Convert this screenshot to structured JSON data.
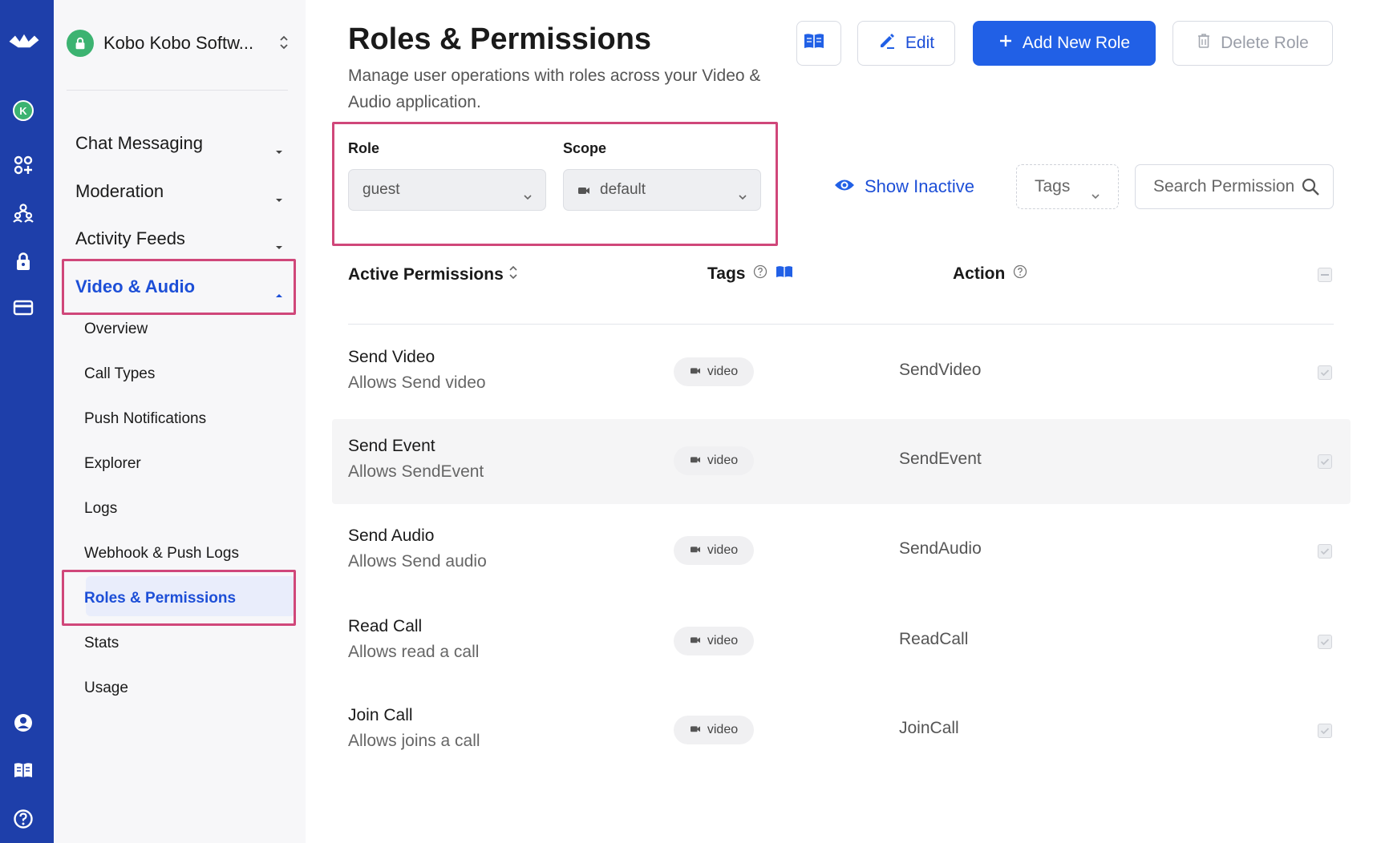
{
  "rail": {
    "icons": [
      "stream-logo-icon",
      "org-avatar-icon",
      "apps-icon",
      "users-icon",
      "lock-icon",
      "billing-card-icon",
      "account-icon",
      "docs-book-icon",
      "help-icon"
    ],
    "avatar_letter": "K"
  },
  "sidebar": {
    "org_name": "Kobo Kobo Softw...",
    "sections": [
      {
        "label": "Chat Messaging",
        "expanded": false
      },
      {
        "label": "Moderation",
        "expanded": false
      },
      {
        "label": "Activity Feeds",
        "expanded": false
      },
      {
        "label": "Video & Audio",
        "expanded": true
      }
    ],
    "sub_items": [
      "Overview",
      "Call Types",
      "Push Notifications",
      "Explorer",
      "Logs",
      "Webhook & Push Logs",
      "Roles & Permissions",
      "Stats",
      "Usage"
    ],
    "active_sub_item": "Roles & Permissions"
  },
  "header": {
    "title": "Roles & Permissions",
    "subtitle": "Manage user operations with roles across your Video & Audio application.",
    "edit_label": "Edit",
    "add_label": "Add New Role",
    "delete_label": "Delete Role"
  },
  "filters": {
    "role_label": "Role",
    "role_value": "guest",
    "scope_label": "Scope",
    "scope_value": "default",
    "show_inactive_label": "Show Inactive",
    "tags_label": "Tags",
    "search_placeholder": "Search Permissions"
  },
  "table": {
    "col_permissions": "Active Permissions",
    "col_tags": "Tags",
    "col_action": "Action",
    "rows": [
      {
        "name": "Send Video",
        "description": "Allows Send video",
        "tag": "video",
        "action": "SendVideo",
        "checked": true
      },
      {
        "name": "Send Event",
        "description": "Allows SendEvent",
        "tag": "video",
        "action": "SendEvent",
        "checked": true
      },
      {
        "name": "Send Audio",
        "description": "Allows Send audio",
        "tag": "video",
        "action": "SendAudio",
        "checked": true
      },
      {
        "name": "Read Call",
        "description": "Allows read a call",
        "tag": "video",
        "action": "ReadCall",
        "checked": true
      },
      {
        "name": "Join Call",
        "description": "Allows joins a call",
        "tag": "video",
        "action": "JoinCall",
        "checked": true
      }
    ]
  },
  "colors": {
    "rail": "#1e3faa",
    "accent": "#2160e6",
    "highlight": "#d0477a",
    "org_badge": "#3cb371"
  }
}
